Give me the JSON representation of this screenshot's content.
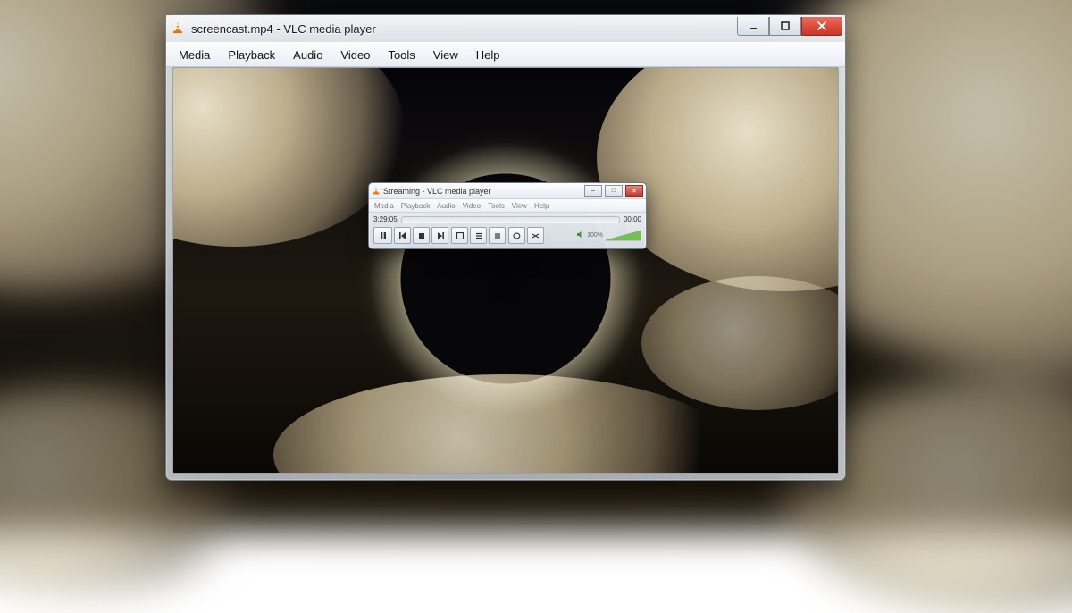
{
  "main_window": {
    "title": "screencast.mp4 - VLC media player",
    "icon": "vlc-cone-icon",
    "menu": [
      "Media",
      "Playback",
      "Audio",
      "Video",
      "Tools",
      "View",
      "Help"
    ],
    "controls": {
      "minimize": "minimize",
      "maximize": "maximize",
      "close": "close"
    }
  },
  "mini_window": {
    "title": "Streaming - VLC media player",
    "icon": "vlc-cone-icon",
    "menu": [
      "Media",
      "Playback",
      "Audio",
      "Video",
      "Tools",
      "View",
      "Help"
    ],
    "time_elapsed": "3:29:05",
    "time_total": "00:00",
    "volume_label": "100%",
    "buttons": {
      "play": "pause-icon",
      "prev": "previous-icon",
      "stop": "stop-icon",
      "next": "next-icon",
      "fullscreen": "fullscreen-icon",
      "playlist": "playlist-icon",
      "extended": "extended-settings-icon",
      "loop": "loop-icon",
      "shuffle": "shuffle-icon"
    }
  }
}
